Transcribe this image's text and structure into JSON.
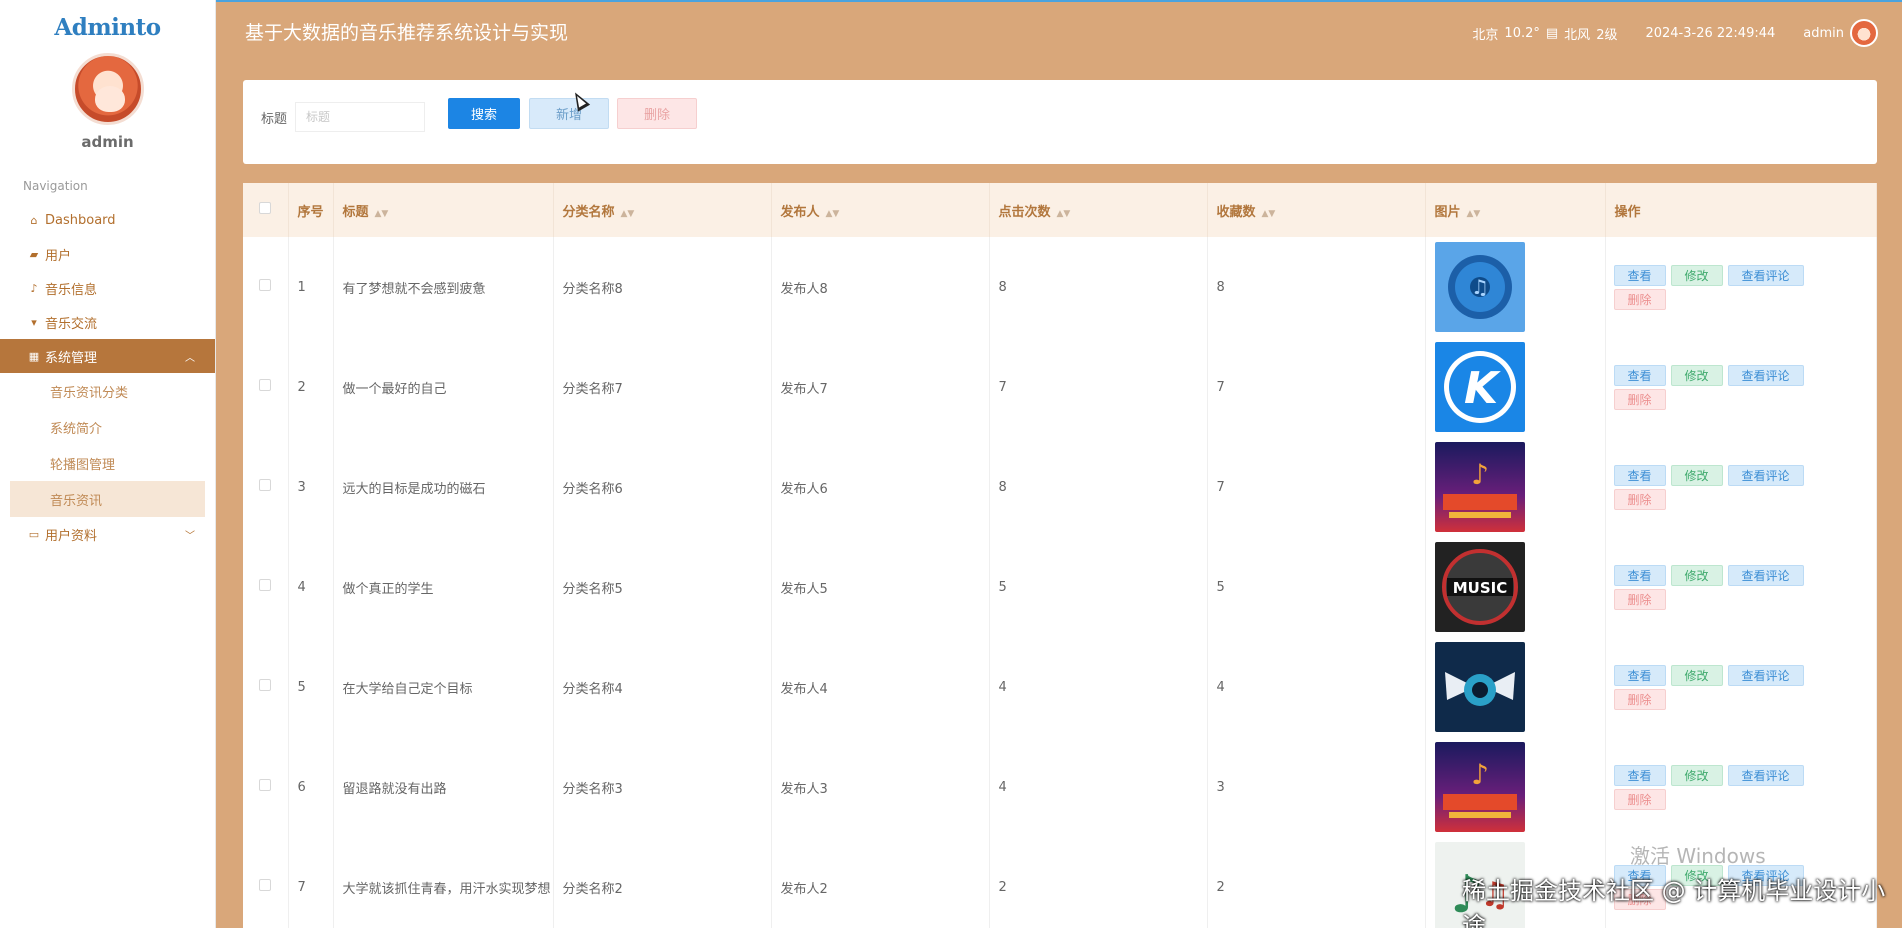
{
  "sidebar": {
    "logo": "Adminto",
    "username": "admin",
    "nav_heading": "Navigation",
    "items": [
      {
        "label": "Dashboard",
        "icon": "home-icon"
      },
      {
        "label": "用户",
        "icon": "user-icon"
      },
      {
        "label": "音乐信息",
        "icon": "music-icon"
      },
      {
        "label": "音乐交流",
        "icon": "chat-icon"
      },
      {
        "label": "系统管理",
        "icon": "grid-icon",
        "active": true
      },
      {
        "label": "用户资料",
        "icon": "profile-icon"
      }
    ],
    "subitems": [
      "音乐资讯分类",
      "系统简介",
      "轮播图管理",
      "音乐资讯"
    ],
    "active_subitem": "音乐资讯"
  },
  "header": {
    "title": "基于大数据的音乐推荐系统设计与实现",
    "city": "北京",
    "temperature": "10.2°",
    "wind": "北风",
    "wind_level": "2级",
    "datetime": "2024-3-26 22:49:44",
    "user": "admin"
  },
  "search": {
    "label": "标题",
    "placeholder": "标题",
    "search_button": "搜索",
    "add_button": "新增",
    "delete_button": "删除"
  },
  "table": {
    "columns": [
      "序号",
      "标题",
      "分类名称",
      "发布人",
      "点击次数",
      "收藏数",
      "图片",
      "操作"
    ],
    "actions": {
      "view": "查看",
      "edit": "修改",
      "comments": "查看评论",
      "delete": "删除"
    },
    "rows": [
      {
        "no": "1",
        "title": "有了梦想就不会感到疲惫",
        "category": "分类名称8",
        "publisher": "发布人8",
        "clicks": "8",
        "favorites": "8",
        "image": "blue-disc-icon"
      },
      {
        "no": "2",
        "title": "做一个最好的自己",
        "category": "分类名称7",
        "publisher": "发布人7",
        "clicks": "7",
        "favorites": "7",
        "image": "k-logo-icon"
      },
      {
        "no": "3",
        "title": "远大的目标是成功的磁石",
        "category": "分类名称6",
        "publisher": "发布人6",
        "clicks": "8",
        "favorites": "7",
        "image": "music-poster-icon"
      },
      {
        "no": "4",
        "title": "做个真正的学生",
        "category": "分类名称5",
        "publisher": "发布人5",
        "clicks": "5",
        "favorites": "5",
        "image": "music-badge-icon"
      },
      {
        "no": "5",
        "title": "在大学给自己定个目标",
        "category": "分类名称4",
        "publisher": "发布人4",
        "clicks": "4",
        "favorites": "4",
        "image": "winged-headphones-icon"
      },
      {
        "no": "6",
        "title": "留退路就没有出路",
        "category": "分类名称3",
        "publisher": "发布人3",
        "clicks": "4",
        "favorites": "3",
        "image": "music-poster-icon"
      },
      {
        "no": "7",
        "title": "大学就该抓住青春，用汗水实现梦想",
        "category": "分类名称2",
        "publisher": "发布人2",
        "clicks": "2",
        "favorites": "2",
        "image": "music-note-icon"
      }
    ]
  },
  "overlays": {
    "windows_watermark": "激活 Windows",
    "site_watermark": "稀土掘金技术社区 @ 计算机毕业设计小途"
  },
  "colors": {
    "header_bg": "#d9a77a",
    "sidebar_active": "#b6763c",
    "primary_button": "#1c85e4"
  }
}
